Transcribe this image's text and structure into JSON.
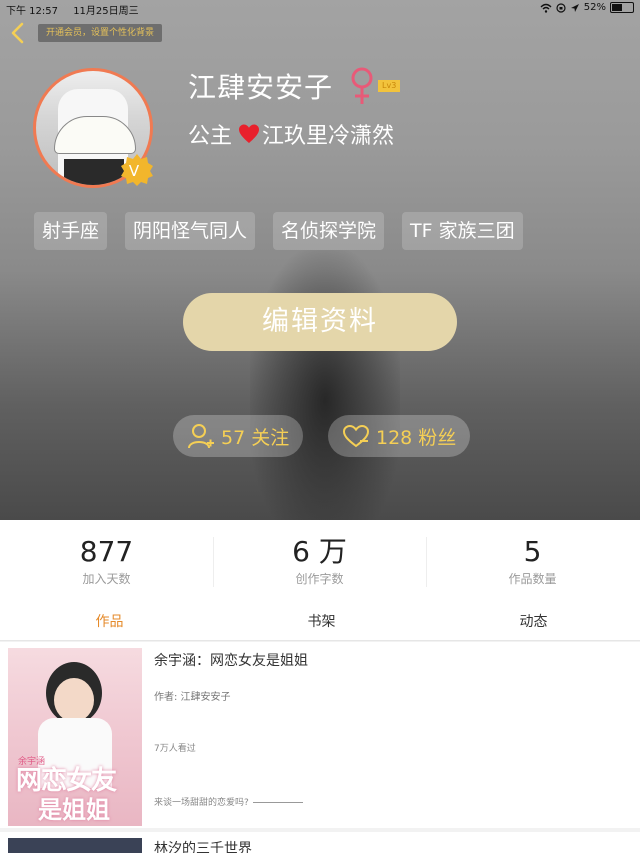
{
  "status_bar": {
    "time": "下午 12:57",
    "date": "11月25日周三",
    "battery": "52%",
    "battery_level": 0.52
  },
  "header": {
    "vip_hint": "开通会员，设置个性化背景"
  },
  "profile": {
    "name": "江肆安安子",
    "gender": "female",
    "level": "Lv3",
    "vip_badge": "V",
    "signature_prefix": "公主",
    "signature_suffix": "江玖里冷潇然",
    "tags": [
      "射手座",
      "阴阳怪气同人",
      "名侦探学院",
      "TF 家族三团"
    ],
    "edit_button": "编辑资料",
    "follow_label": "57 关注",
    "fans_label": "128 粉丝"
  },
  "stats": [
    {
      "value": "877",
      "label": "加入天数"
    },
    {
      "value": "6 万",
      "label": "创作字数"
    },
    {
      "value": "5",
      "label": "作品数量"
    }
  ],
  "tabs": [
    {
      "label": "作品",
      "active": true
    },
    {
      "label": "书架",
      "active": false
    },
    {
      "label": "动态",
      "active": false
    }
  ],
  "works": [
    {
      "title": "余宇涵：网恋女友是姐姐",
      "author": "作者: 江肆安安子",
      "views": "7万人看过",
      "description": "来谈一场甜甜的恋爱吗?",
      "cover_text_1": "网恋女友",
      "cover_text_2": "是姐姐",
      "cover_text_small": "余宇涵"
    },
    {
      "title": "林汐的三千世界"
    }
  ],
  "colors": {
    "accent": "#e58a2a",
    "gold": "#f5cf55",
    "edit_button_bg": "#e4d6aa",
    "avatar_border": "#f07a52",
    "female_symbol": "#e85a78"
  }
}
